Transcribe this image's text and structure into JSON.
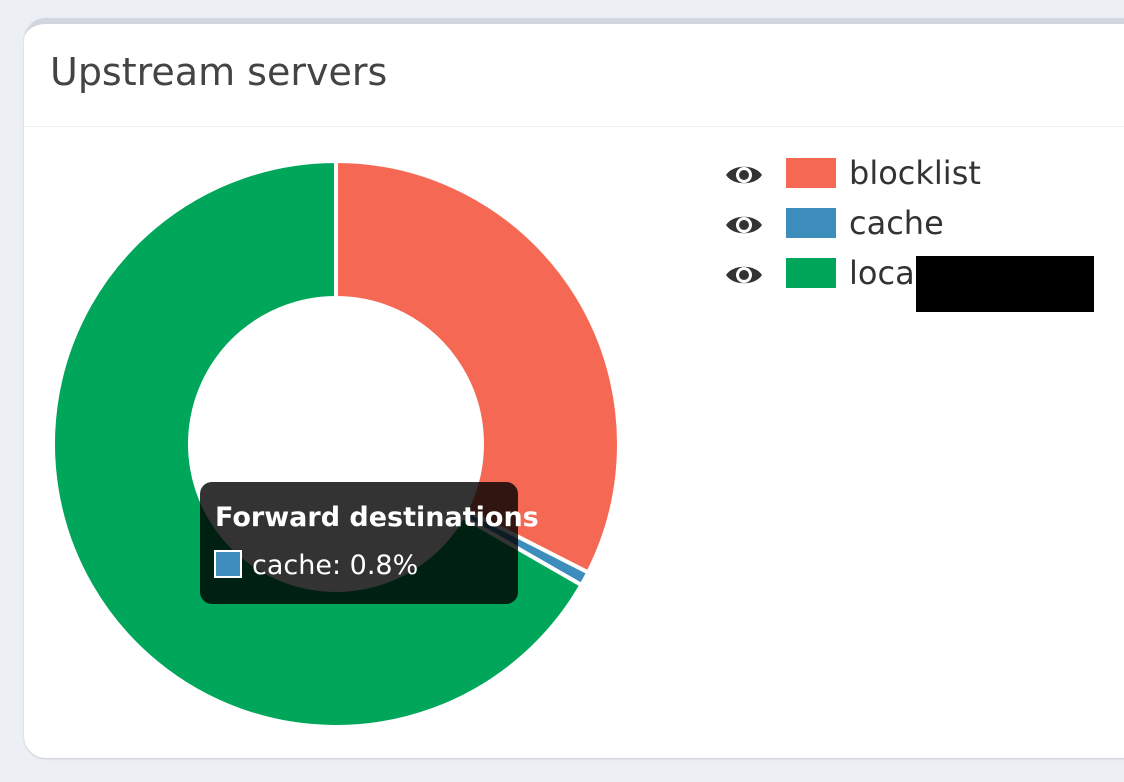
{
  "card": {
    "title": "Upstream servers"
  },
  "chart_data": {
    "type": "pie",
    "donut": true,
    "categories": [
      "blocklist",
      "cache",
      "local"
    ],
    "values": [
      32.5,
      0.8,
      66.7
    ],
    "colors": [
      "#f56954",
      "#3c8dbc",
      "#00a65a"
    ],
    "legend_position": "right"
  },
  "legend": {
    "items": [
      {
        "label": "blocklist",
        "color": "#f56954",
        "icon": "eye-icon"
      },
      {
        "label": "cache",
        "color": "#3c8dbc",
        "icon": "eye-icon"
      },
      {
        "label": "local",
        "color": "#00a65a",
        "icon": "eye-icon"
      }
    ]
  },
  "tooltip": {
    "title": "Forward destinations",
    "body": "cache: 0.8%",
    "swatch_color": "#3c8dbc"
  }
}
